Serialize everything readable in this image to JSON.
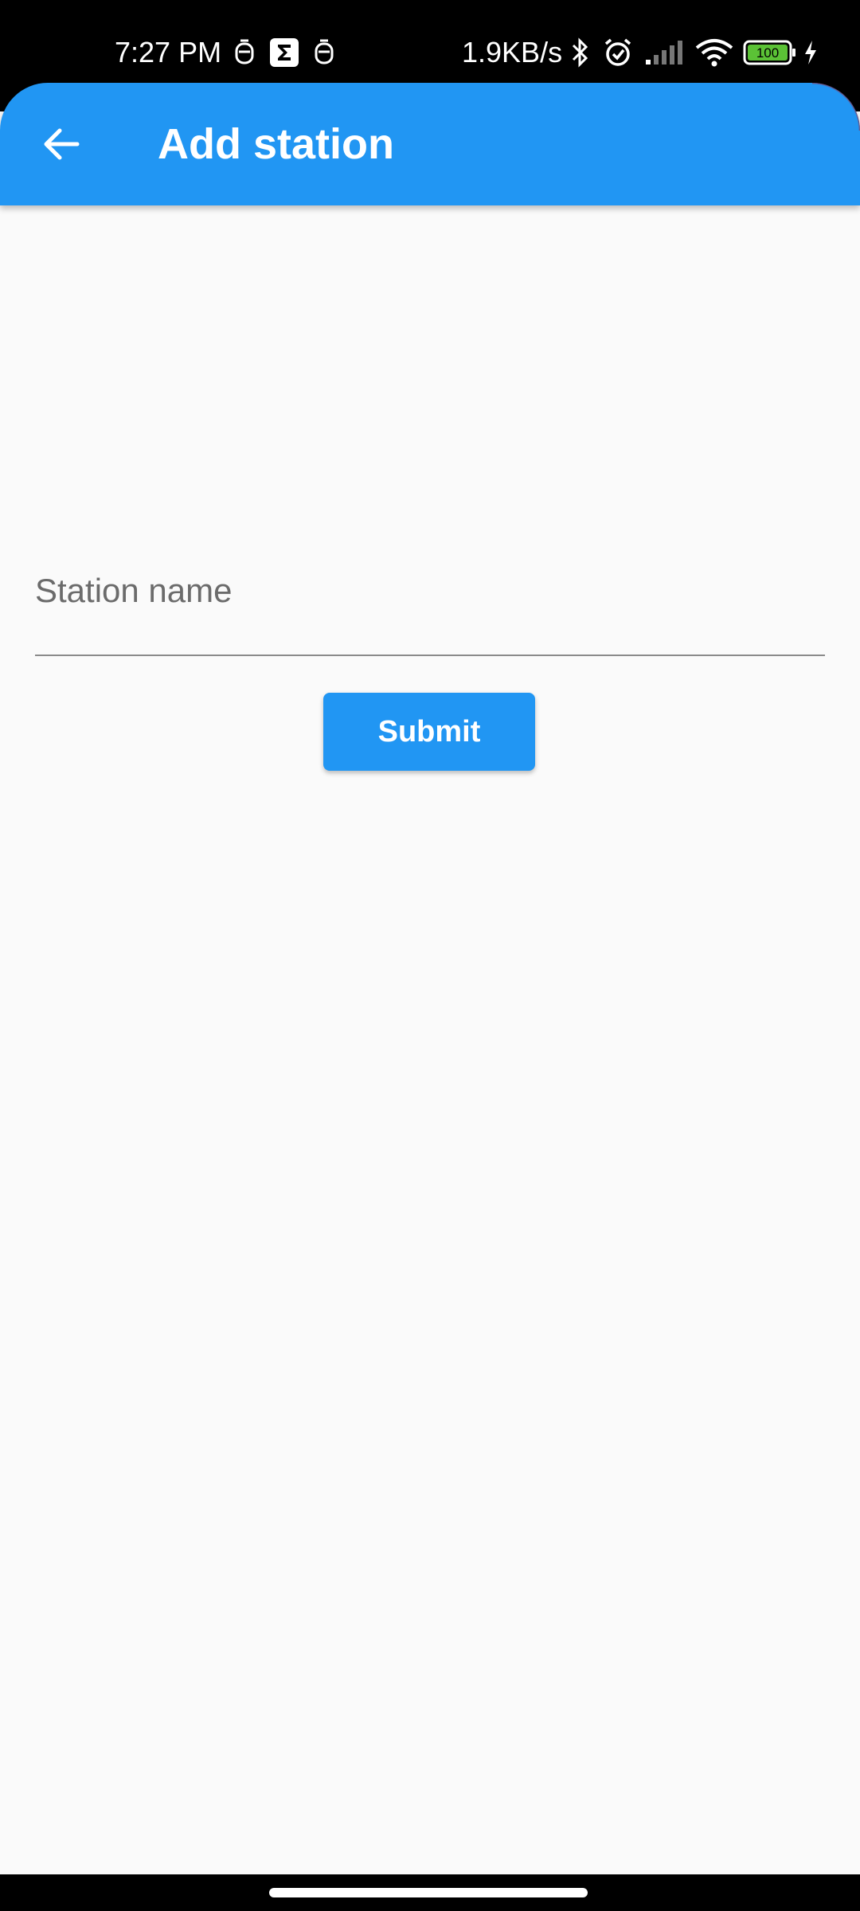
{
  "status_bar": {
    "time": "7:27 PM",
    "network_speed": "1.9KB/s",
    "battery_level": "100",
    "icons": [
      "notification-icon",
      "sigma-app-icon",
      "notification-icon",
      "bluetooth-icon",
      "alarm-icon",
      "signal-icon",
      "wifi-icon",
      "battery-icon",
      "charging-icon"
    ]
  },
  "app_bar": {
    "title": "Add station",
    "back_icon": "arrow-back-icon",
    "color": "#2196f3"
  },
  "form": {
    "station_name_placeholder": "Station name",
    "station_name_value": "",
    "submit_label": "Submit"
  },
  "colors": {
    "accent": "#2196f3",
    "background": "#fafafa"
  }
}
